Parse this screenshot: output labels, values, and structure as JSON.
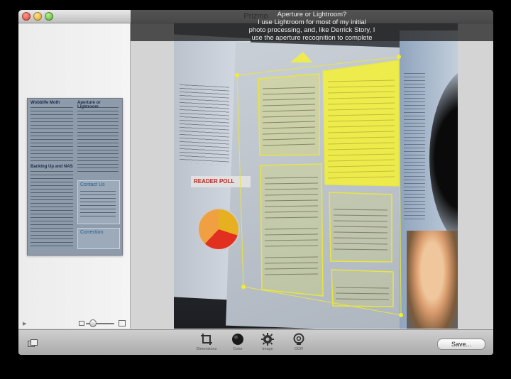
{
  "window": {
    "title": "Prizmo"
  },
  "tooltip": {
    "lines": [
      "Aperture or Lightroom?",
      "I use Lightroom for most of my initial",
      "photo processing, and, like Derrick Story, I",
      "use the aperture recognition to complete"
    ]
  },
  "thumbnail": {
    "h1": "Wobblife Moth",
    "h2": "Aperture or Lightroom",
    "h3": "Backing Up and NAS",
    "h4": "Contact Us",
    "h5": "Correction"
  },
  "photo": {
    "reader_poll": "READER POLL"
  },
  "toolbar": {
    "tools": [
      {
        "id": "dimensions",
        "label": "Dimensions",
        "icon": "crop-icon"
      },
      {
        "id": "color",
        "label": "Color",
        "icon": "color-icon"
      },
      {
        "id": "image",
        "label": "Image",
        "icon": "gear-icon"
      },
      {
        "id": "ocr",
        "label": "OCR",
        "icon": "ocr-icon"
      }
    ],
    "save_label": "Save..."
  },
  "colors": {
    "highlight": "#f4f03a",
    "region_border": "#e8e640",
    "handle": "#f2ee2c"
  }
}
